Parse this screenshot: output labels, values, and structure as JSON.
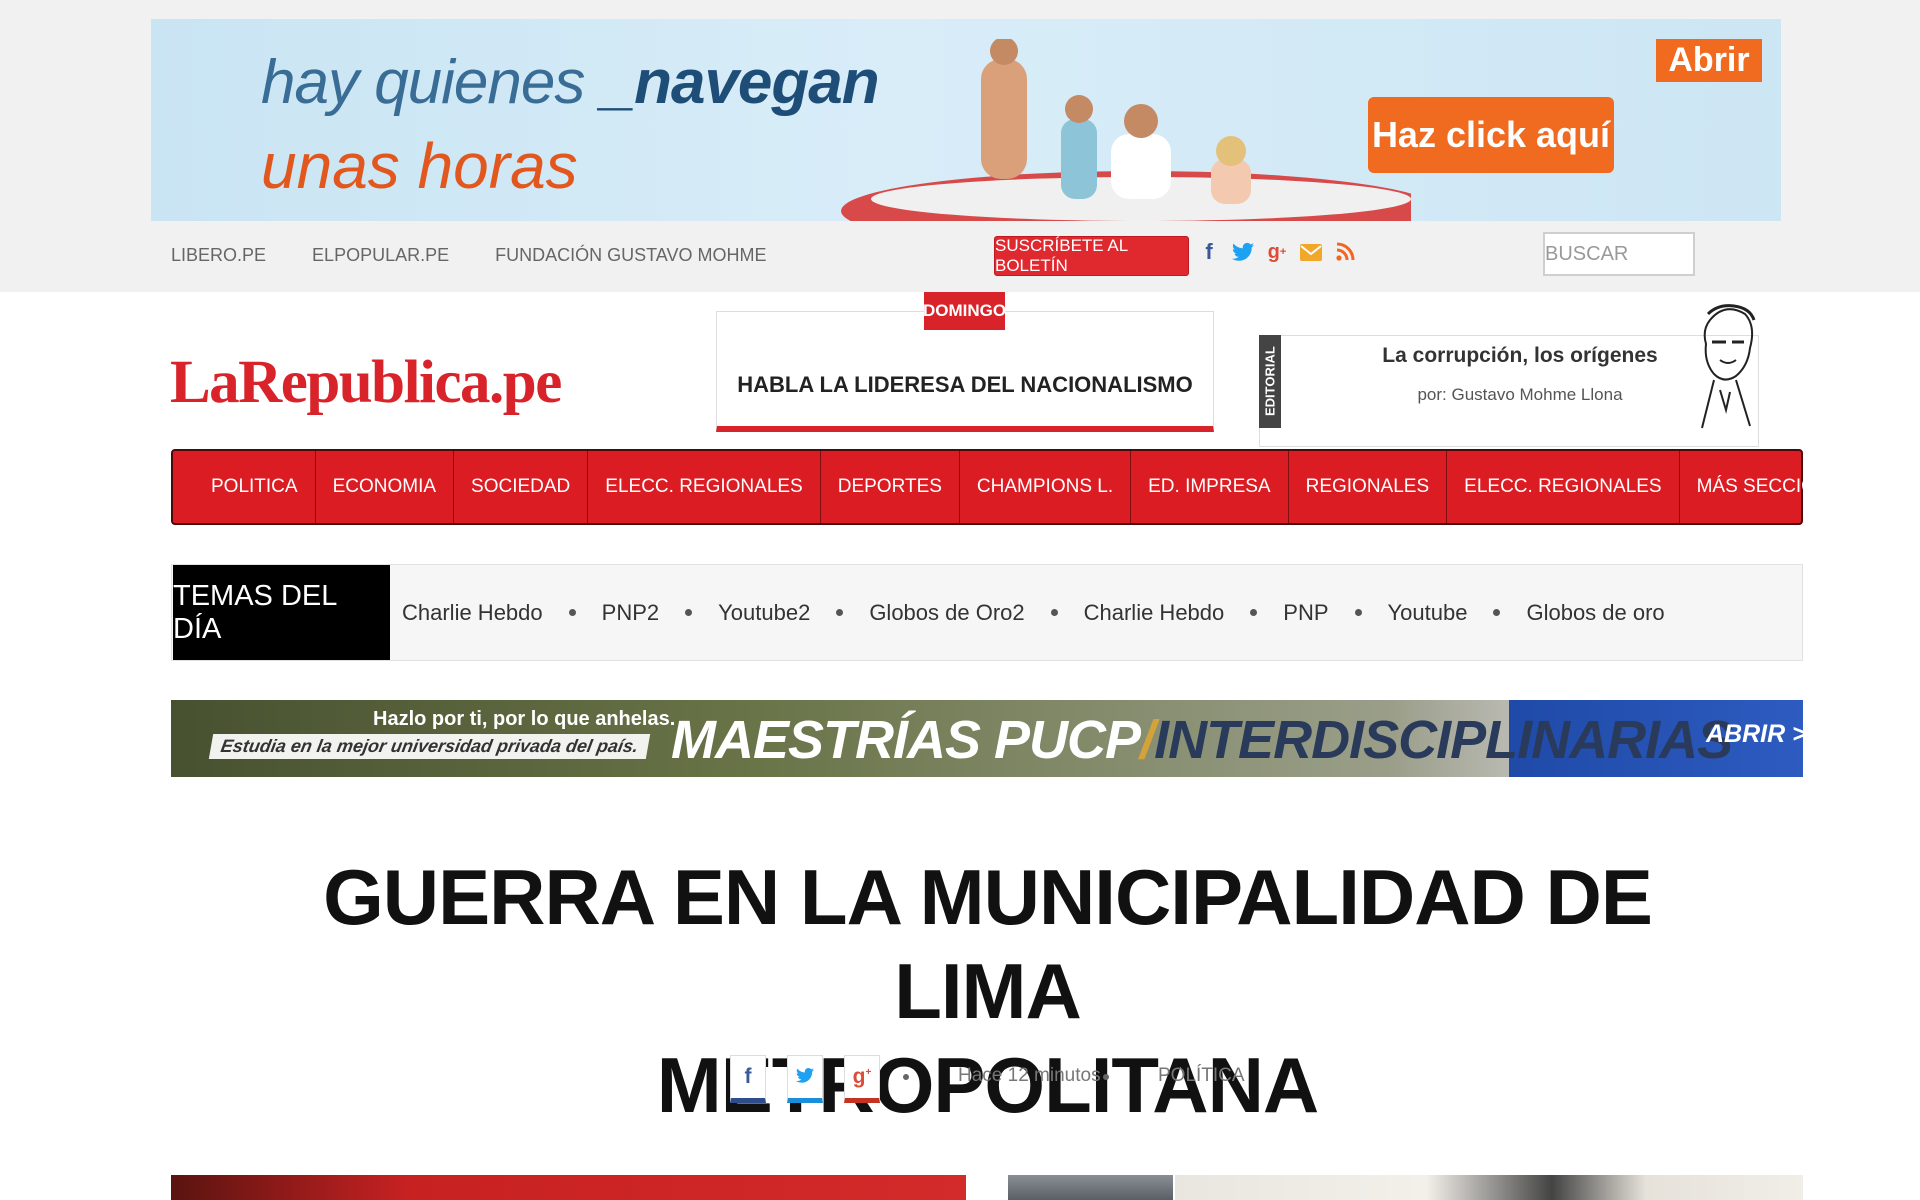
{
  "ad_top": {
    "line1_prefix": "hay quienes ",
    "line1_emphasis": "_navegan",
    "line2": "unas horas",
    "cta_open": "Abrir",
    "cta_click": "Haz click aquí"
  },
  "util_links": [
    "LIBERO.PE",
    "ELPOPULAR.PE",
    "FUNDACIÓN GUSTAVO MOHME"
  ],
  "subscribe_label": "SUSCRÍBETE AL BOLETÍN",
  "social_icons": [
    "facebook-icon",
    "twitter-icon",
    "google-plus-icon",
    "email-icon",
    "rss-icon"
  ],
  "search": {
    "placeholder": "BUSCAR"
  },
  "logo": "LaRepublica.pe",
  "domingo": {
    "tag": "DOMINGO",
    "text": "HABLA LA LIDERESA DEL NACIONALISMO"
  },
  "editorial": {
    "tab": "EDITORIAL",
    "title": "La corrupción, los orígenes",
    "author": "por: Gustavo Mohme Llona"
  },
  "nav": {
    "items": [
      "POLITICA",
      "ECONOMIA",
      "SOCIEDAD",
      "ELECC. REGIONALES",
      "DEPORTES",
      "CHAMPIONS L.",
      "ED. IMPRESA",
      "REGIONALES",
      "ELECC. REGIONALES"
    ],
    "more": "MÁS SECCIONES"
  },
  "temas": {
    "label": "TEMAS DEL DÍA",
    "topics": [
      "Charlie Hebdo",
      "PNP2",
      "Youtube2",
      "Globos de Oro2",
      "Charlie Hebdo",
      "PNP",
      "Youtube",
      "Globos de oro"
    ]
  },
  "ad_mid": {
    "tagline": "Hazlo por ti, por lo que anhelas.",
    "subline": "Estudia en la mejor universidad privada del país.",
    "main_a": "MAESTRÍAS PUCP",
    "slash": "/",
    "main_b": "INTERDISCIPLINARIAS",
    "cta": "ABRIR >"
  },
  "article": {
    "headline_1": "GUERRA EN LA MUNICIPALIDAD DE LIMA",
    "headline_2": "METROPOLITANA",
    "time": "Hace 12 minutos",
    "section": "POLÍTICA"
  },
  "colors": {
    "brand_red": "#dc1c23",
    "ad_orange": "#f06a1f",
    "facebook": "#3b5998",
    "twitter": "#1da1f2",
    "google_plus": "#dd4b39"
  }
}
